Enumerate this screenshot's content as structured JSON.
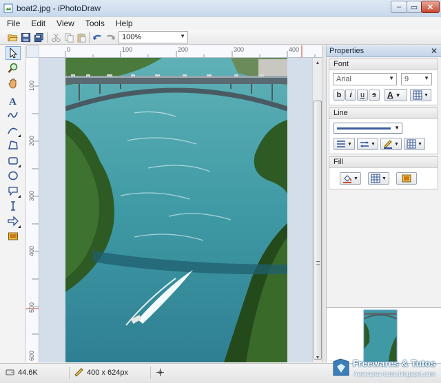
{
  "window": {
    "title": "boat2.jpg - iPhotoDraw",
    "min": "–",
    "max": "▭",
    "close": "✕"
  },
  "menu": [
    "File",
    "Edit",
    "View",
    "Tools",
    "Help"
  ],
  "toolbar": {
    "zoom": "100%"
  },
  "rulers": {
    "h_ticks": [
      "0",
      "100",
      "200",
      "300",
      "400"
    ],
    "v_ticks": [
      "100",
      "200",
      "300",
      "400",
      "500",
      "600"
    ]
  },
  "properties": {
    "title": "Properties",
    "font": {
      "header": "Font",
      "family": "Arial",
      "size": "9",
      "bold": "b",
      "italic": "i",
      "underline": "u",
      "strike": "s",
      "color_letter": "A"
    },
    "line": {
      "header": "Line"
    },
    "fill": {
      "header": "Fill"
    }
  },
  "status": {
    "filesize": "44.6K",
    "dimensions": "400 x 624px"
  },
  "watermark": {
    "title": "Freewares & Tutos",
    "url": "freewares-tutos.blogspot.com"
  },
  "colors": {
    "accent": "#3a5ca0",
    "water": "#3f9aa5",
    "forest": "#2e5a24"
  }
}
